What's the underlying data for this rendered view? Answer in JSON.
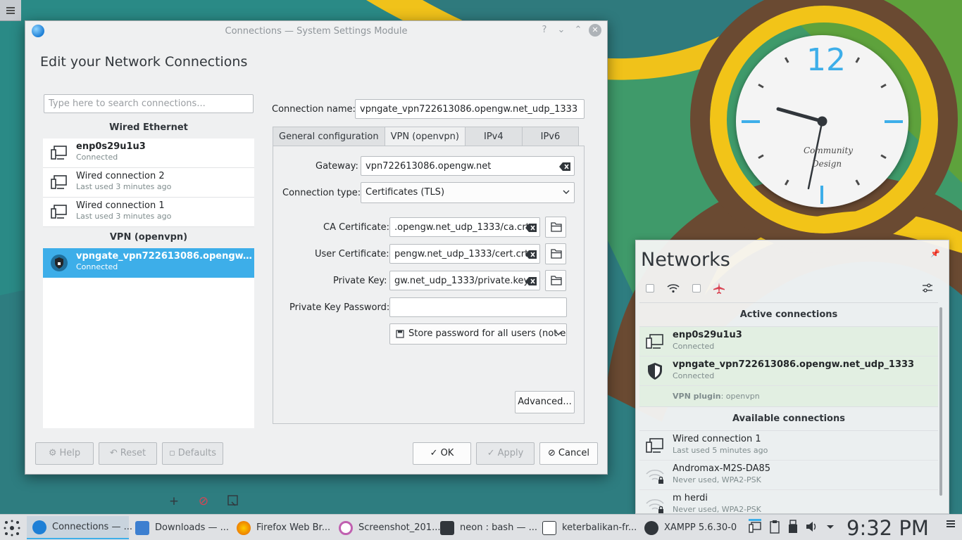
{
  "window": {
    "title": "Connections — System Settings Module",
    "heading": "Edit your Network Connections",
    "title_buttons": [
      "?",
      "⌄",
      "⌃",
      "✕"
    ]
  },
  "search": {
    "placeholder": "Type here to search connections..."
  },
  "connection_list": {
    "wired_header": "Wired Ethernet",
    "wired": [
      {
        "name": "enp0s29u1u3",
        "status": "Connected",
        "bold": true
      },
      {
        "name": "Wired connection 2",
        "status": "Last used 3 minutes ago",
        "bold": false
      },
      {
        "name": "Wired connection 1",
        "status": "Last used 3 minutes ago",
        "bold": false
      }
    ],
    "vpn_header": "VPN (openvpn)",
    "vpn": [
      {
        "name": "vpngate_vpn722613086.opengw.net...",
        "status": "Connected",
        "selected": true
      }
    ]
  },
  "editor": {
    "connection_name_label": "Connection name:",
    "connection_name_value": "vpngate_vpn722613086.opengw.net_udp_1333",
    "tabs": [
      "General configuration",
      "VPN (openvpn)",
      "IPv4",
      "IPv6"
    ],
    "active_tab": "VPN (openvpn)",
    "gateway_label": "Gateway:",
    "gateway_value": "vpn722613086.opengw.net",
    "connection_type_label": "Connection type:",
    "connection_type_value": "Certificates (TLS)",
    "ca_label": "CA Certificate:",
    "ca_value": ".opengw.net_udp_1333/ca.crt",
    "user_cert_label": "User Certificate:",
    "user_cert_value": "pengw.net_udp_1333/cert.crt",
    "private_key_label": "Private Key:",
    "private_key_value": "gw.net_udp_1333/private.key",
    "private_key_password_label": "Private Key Password:",
    "private_key_password_value": "",
    "store_password_value": "Store password for all users (not e",
    "advanced_label": "Advanced..."
  },
  "buttons": {
    "help": "Help",
    "reset": "Reset",
    "defaults": "Defaults",
    "ok": "OK",
    "apply": "Apply",
    "cancel": "Cancel"
  },
  "networks_popup": {
    "title": "Networks",
    "active_header": "Active connections",
    "active": [
      {
        "name": "enp0s29u1u3",
        "status": "Connected"
      },
      {
        "name": "vpngate_vpn722613086.opengw.net_udp_1333",
        "status": "Connected"
      }
    ],
    "vpn_plugin_label": "VPN plugin",
    "vpn_plugin_value": ": openvpn",
    "available_header": "Available connections",
    "available": [
      {
        "name": "Wired connection 1",
        "status": "Last used 5 minutes ago",
        "icon": "wired-icon"
      },
      {
        "name": "Andromax-M2S-DA85",
        "status": "Never used, WPA2-PSK",
        "icon": "wifi-locked-icon"
      },
      {
        "name": "m herdi",
        "status": "Never used, WPA2-PSK",
        "icon": "wifi-locked-icon"
      }
    ]
  },
  "clock_widget": {
    "twelve": "12",
    "brand": "Community",
    "brand2": "Design"
  },
  "taskbar": {
    "tasks": [
      {
        "label": "Connections — ...",
        "color": "#1d7fd6",
        "active": true
      },
      {
        "label": "Downloads — ...",
        "color": "#3d7fd0",
        "active": false
      },
      {
        "label": "Firefox Web Br...",
        "color": "#e66000",
        "active": false
      },
      {
        "label": "Screenshot_201...",
        "color": "#c060b0",
        "active": false
      },
      {
        "label": "neon : bash — ...",
        "color": "#31363b",
        "active": false
      },
      {
        "label": "keterbalikan-fr...",
        "color": "#ffffff",
        "active": false
      },
      {
        "label": "XAMPP 5.6.30-0",
        "color": "#31363b",
        "active": false
      }
    ],
    "time": "9:32 PM"
  },
  "colors": {
    "accent": "#3daee9",
    "window_bg": "#eff0f1"
  }
}
